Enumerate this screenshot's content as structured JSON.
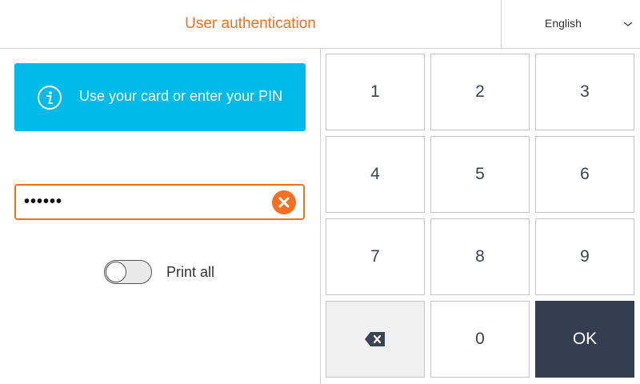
{
  "header": {
    "title": "User authentication",
    "language": "English"
  },
  "info": {
    "message": "Use your card or enter your PIN",
    "icon": "info-icon"
  },
  "pin": {
    "masked_value": "••••••"
  },
  "print_all": {
    "label": "Print all",
    "enabled": false
  },
  "keypad": {
    "keys": [
      "1",
      "2",
      "3",
      "4",
      "5",
      "6",
      "7",
      "8",
      "9",
      "",
      "0",
      "OK"
    ]
  },
  "colors": {
    "accent": "#f36f21",
    "info": "#00baea",
    "ok": "#333f50"
  }
}
